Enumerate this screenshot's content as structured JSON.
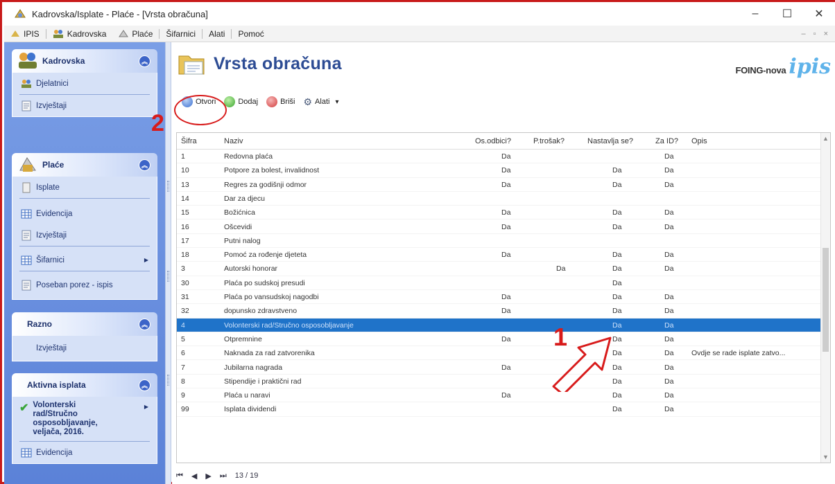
{
  "window": {
    "title": "Kadrovska/Isplate - Plaće - [Vrsta obračuna]",
    "controls": [
      "–",
      "☐",
      "✕"
    ]
  },
  "menu": [
    "IPIS",
    "Kadrovska",
    "Plaće",
    "Šifarnici",
    "Alati",
    "Pomoć"
  ],
  "mdi_controls": "– ▫ ×",
  "sidebar": {
    "kadrovska": {
      "title": "Kadrovska",
      "items": [
        "Djelatnici",
        "Izvještaji"
      ]
    },
    "place": {
      "title": "Plaće",
      "items": [
        "Isplate",
        "Evidencija",
        "Izvještaji",
        "Šifarnici",
        "Poseban porez - ispis"
      ]
    },
    "razno": {
      "title": "Razno",
      "items": [
        "Izvještaji"
      ]
    },
    "aktivna": {
      "title": "Aktivna isplata",
      "item": "Volonterski rad/Stručno osposobljavanje, veljača, 2016.",
      "evidencija": "Evidencija"
    }
  },
  "header": {
    "title": "Vrsta obračuna",
    "brand_prefix": "FOING-nova",
    "brand_logo": "ipis"
  },
  "toolbar": {
    "otvori": "Otvori",
    "dodaj": "Dodaj",
    "brisi": "Briši",
    "alati": "Alati",
    "alati_arrow": "▾"
  },
  "annotations": {
    "one": "1",
    "two": "2"
  },
  "grid": {
    "columns": [
      "Šifra",
      "Naziv",
      "Os.odbici?",
      "P.trošak?",
      "Nastavlja se?",
      "Za ID?",
      "Opis"
    ],
    "rows": [
      [
        "1",
        "Redovna plaća",
        "Da",
        "",
        "",
        "Da",
        ""
      ],
      [
        "10",
        "Potpore za bolest, invalidnost",
        "Da",
        "",
        "Da",
        "Da",
        ""
      ],
      [
        "13",
        "Regres za godišnji odmor",
        "Da",
        "",
        "Da",
        "Da",
        ""
      ],
      [
        "14",
        "Dar za djecu",
        "",
        "",
        "",
        "",
        ""
      ],
      [
        "15",
        "Božićnica",
        "Da",
        "",
        "Da",
        "Da",
        ""
      ],
      [
        "16",
        "Ošcevidi",
        "Da",
        "",
        "Da",
        "Da",
        ""
      ],
      [
        "17",
        "Putni nalog",
        "",
        "",
        "",
        "",
        ""
      ],
      [
        "18",
        "Pomoć za rođenje djeteta",
        "Da",
        "",
        "Da",
        "Da",
        ""
      ],
      [
        "3",
        "Autorski honorar",
        "",
        "Da",
        "Da",
        "Da",
        ""
      ],
      [
        "30",
        "Plaća po sudskoj presudi",
        "",
        "",
        "Da",
        "",
        ""
      ],
      [
        "31",
        "Plaća po vansudskoj nagodbi",
        "Da",
        "",
        "Da",
        "Da",
        ""
      ],
      [
        "32",
        "dopunsko zdravstveno",
        "Da",
        "",
        "Da",
        "Da",
        ""
      ],
      [
        "4",
        "Volonterski rad/Stručno osposobljavanje",
        "",
        "",
        "Da",
        "Da",
        ""
      ],
      [
        "5",
        "Otpremnine",
        "Da",
        "",
        "Da",
        "Da",
        ""
      ],
      [
        "6",
        "Naknada za rad zatvorenika",
        "",
        "",
        "Da",
        "Da",
        "Ovdje se rade isplate zatvo..."
      ],
      [
        "7",
        "Jubilarna nagrada",
        "Da",
        "",
        "Da",
        "Da",
        ""
      ],
      [
        "8",
        "Stipendije i praktični rad",
        "",
        "",
        "Da",
        "Da",
        ""
      ],
      [
        "9",
        "Plaća u naravi",
        "Da",
        "",
        "Da",
        "Da",
        ""
      ],
      [
        "99",
        "Isplata dividendi",
        "",
        "",
        "Da",
        "Da",
        ""
      ]
    ],
    "selected_index": 12
  },
  "navigator": {
    "first": "⏮",
    "prev": "◀",
    "next": "▶",
    "last": "⏭",
    "position": "13 / 19"
  },
  "colors": {
    "selection": "#1f73c9",
    "sidebar": "#6b90df",
    "title": "#2d4c94",
    "annotation": "#d81b1b"
  }
}
